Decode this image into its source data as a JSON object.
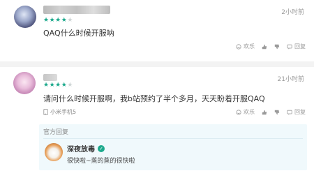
{
  "reviews": [
    {
      "time": "2小时前",
      "rating": 4,
      "text": "QAQ什么时候开服呐",
      "actions": {
        "fun": "欢乐",
        "reply": "回复"
      }
    },
    {
      "time": "21小时前",
      "rating": 4,
      "text": "请问什么时候开服啊，我b站预约了半个多月，天天盼着开服QAQ",
      "device": "小米手机5",
      "actions": {
        "fun": "欢乐",
        "reply": "回复"
      },
      "official_reply": {
        "title": "官方回复",
        "author": "深夜放毒",
        "text": "很快啦~蒸的蒸的很快啦"
      }
    }
  ],
  "colors": {
    "star": "#1ca98c",
    "official_bg": "#f0f9fc"
  }
}
